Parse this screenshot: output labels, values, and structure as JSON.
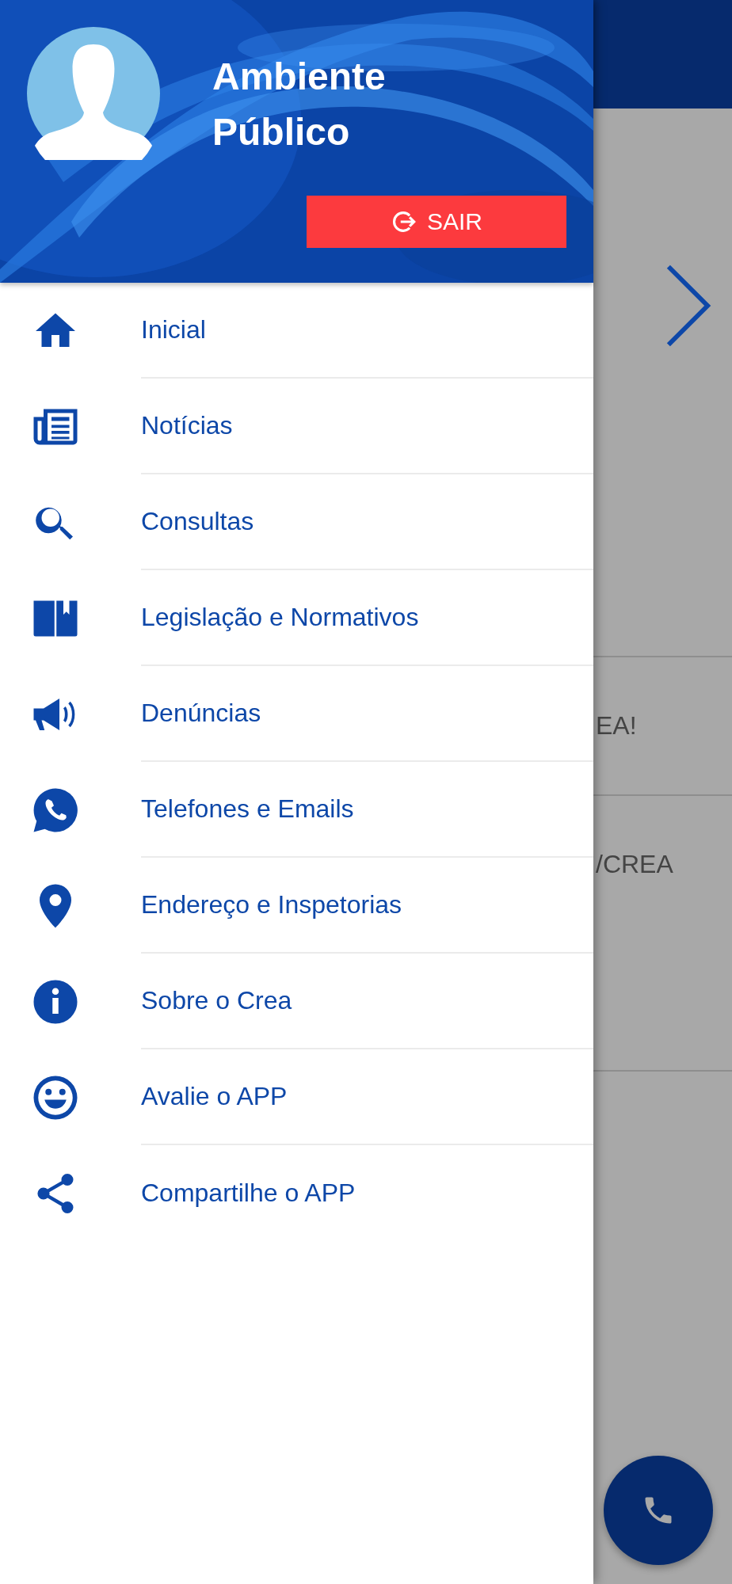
{
  "drawer": {
    "header": {
      "title": "Ambiente Público",
      "logout_button": "SAIR"
    },
    "menu": [
      {
        "label": "Inicial"
      },
      {
        "label": "Notícias"
      },
      {
        "label": "Consultas"
      },
      {
        "label": "Legislação e Normativos"
      },
      {
        "label": "Denúncias"
      },
      {
        "label": "Telefones e Emails"
      },
      {
        "label": "Endereço e Inspetorias"
      },
      {
        "label": "Sobre o Crea"
      },
      {
        "label": "Avalie o APP"
      },
      {
        "label": "Compartilhe o APP"
      }
    ]
  },
  "background": {
    "rows": [
      "EA!",
      "/CREA"
    ]
  }
}
